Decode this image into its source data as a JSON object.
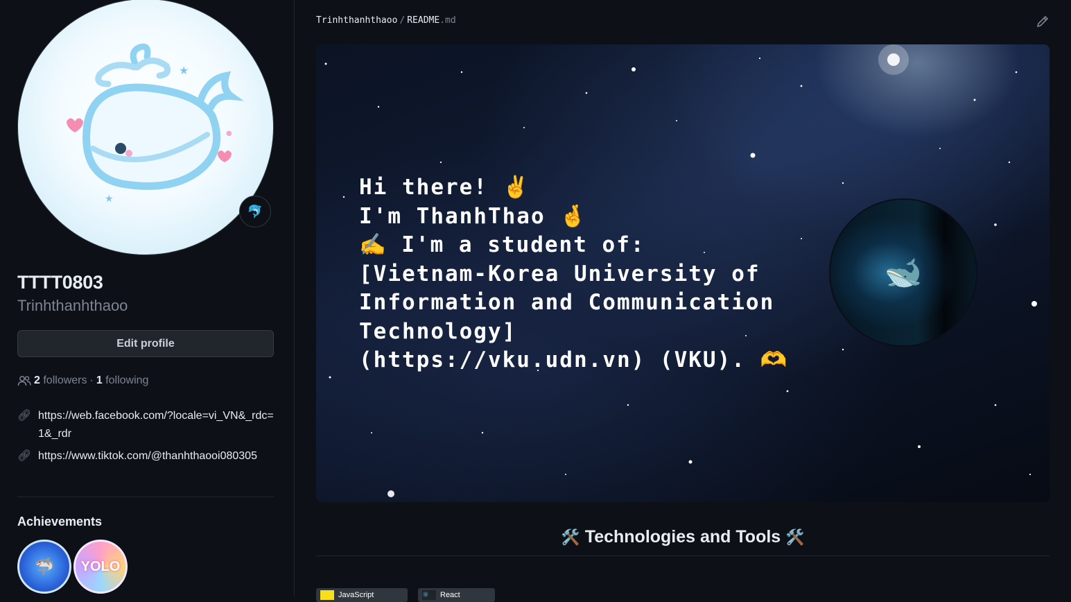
{
  "profile": {
    "display_name": "TTTT0803",
    "username": "Trinhthanhthaoo",
    "edit_label": "Edit profile",
    "followers_count": "2",
    "followers_label": "followers",
    "following_count": "1",
    "following_label": "following",
    "separator": "·",
    "status_icon": "dolphin-icon",
    "links": [
      {
        "text": "https://web.facebook.com/?locale=vi_VN&_rdc=1&_rdr",
        "icon": "link-icon"
      },
      {
        "text": "https://www.tiktok.com/@thanhthaooi080305",
        "icon": "link-icon"
      }
    ],
    "achievements_title": "Achievements",
    "badges": [
      {
        "name": "shark-badge",
        "glyph": "🦈"
      },
      {
        "name": "yolo-badge",
        "glyph": "YOLO"
      }
    ]
  },
  "readme": {
    "breadcrumb_user": "Trinhthanhthaoo",
    "breadcrumb_sep": "/",
    "breadcrumb_file": "README",
    "breadcrumb_ext": ".md",
    "edit_icon": "pencil-icon",
    "banner_lines": [
      "Hi there! ✌️",
      "I'm ThanhThao 🤞",
      "✍️ I'm a student of:",
      "[Vietnam-Korea University of",
      "Information and Communication",
      "Technology]",
      "(https://vku.udn.vn) (VKU). 🫶"
    ],
    "orb_glyph": "🐋",
    "tech_title": "Technologies and Tools",
    "tech_icon": "🛠️",
    "chips": [
      {
        "label": "JavaScript",
        "color": "#f7df1e"
      },
      {
        "label": "React",
        "color": "#20232a"
      }
    ]
  },
  "colors": {
    "background": "#0d1117",
    "border": "#21262d",
    "muted_text": "#7d8590",
    "text": "#e6edf3",
    "accent": "#2f81f7"
  }
}
